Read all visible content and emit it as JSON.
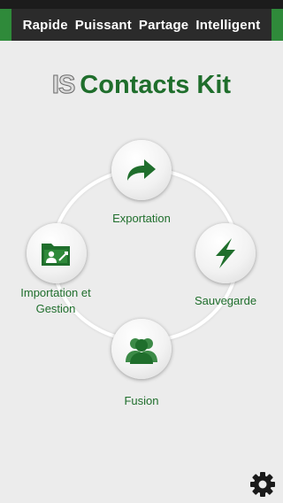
{
  "header": {
    "words": [
      "Rapide",
      "Puissant",
      "Partage",
      "Intelligent"
    ]
  },
  "logo": {
    "prefix": "IS",
    "title": "Contacts Kit"
  },
  "menu": {
    "export_label": "Exportation",
    "backup_label": "Sauvegarde",
    "import_label": "Importation et Gestion",
    "merge_label": "Fusion"
  },
  "colors": {
    "accent_green": "#1f6e2c",
    "header_bg": "#2b2b2b",
    "stripe_green": "#2f8a3a"
  },
  "icons": {
    "export": "arrow-right-icon",
    "backup": "lightning-icon",
    "import": "folder-contacts-icon",
    "merge": "people-icon",
    "settings": "gear-icon"
  }
}
